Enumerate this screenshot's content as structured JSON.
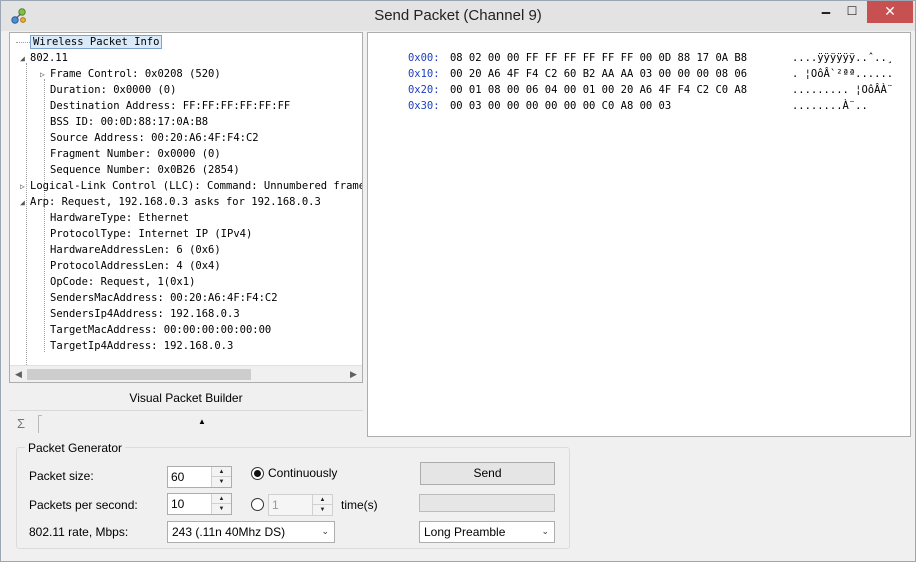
{
  "window": {
    "title": "Send Packet (Channel 9)",
    "minimize_glyph": "🗕",
    "maximize_glyph": "☐",
    "close_glyph": "✕"
  },
  "tree": {
    "rows": [
      {
        "text": "Wireless Packet Info",
        "expander": ""
      },
      {
        "text": "802.11",
        "expander": "◢"
      },
      {
        "text": "Frame Control: 0x0208 (520)",
        "expander": "▷"
      },
      {
        "text": "Duration: 0x0000 (0)",
        "expander": ""
      },
      {
        "text": "Destination Address: FF:FF:FF:FF:FF:FF",
        "expander": ""
      },
      {
        "text": "BSS ID: 00:0D:88:17:0A:B8",
        "expander": ""
      },
      {
        "text": "Source Address: 00:20:A6:4F:F4:C2",
        "expander": ""
      },
      {
        "text": "Fragment Number: 0x0000 (0)",
        "expander": ""
      },
      {
        "text": "Sequence Number: 0x0B26 (2854)",
        "expander": ""
      },
      {
        "text": "Logical-Link Control (LLC): Command: Unnumbered frame,",
        "expander": "▷"
      },
      {
        "text": "Arp: Request, 192.168.0.3 asks for 192.168.0.3",
        "expander": "◢"
      },
      {
        "text": "HardwareType: Ethernet",
        "expander": ""
      },
      {
        "text": "ProtocolType: Internet IP (IPv4)",
        "expander": ""
      },
      {
        "text": "HardwareAddressLen: 6 (0x6)",
        "expander": ""
      },
      {
        "text": "ProtocolAddressLen: 4 (0x4)",
        "expander": ""
      },
      {
        "text": "OpCode: Request, 1(0x1)",
        "expander": ""
      },
      {
        "text": "SendersMacAddress: 00:20:A6:4F:F4:C2",
        "expander": ""
      },
      {
        "text": "SendersIp4Address: 192.168.0.3",
        "expander": ""
      },
      {
        "text": "TargetMacAddress: 00:00:00:00:00:00",
        "expander": ""
      },
      {
        "text": "TargetIp4Address: 192.168.0.3",
        "expander": ""
      }
    ],
    "scroll_left_glyph": "◀",
    "scroll_right_glyph": "▶"
  },
  "visual_builder": {
    "label": "Visual Packet Builder",
    "sigma_glyph": "Σ",
    "collapse_glyph": "▲"
  },
  "hex": {
    "rows": [
      {
        "offset": "0x00:",
        "bytes": "08 02 00 00 FF FF FF FF FF FF 00 0D 88 17 0A B8",
        "ascii": "....ÿÿÿÿÿÿ..ˆ..¸"
      },
      {
        "offset": "0x10:",
        "bytes": "00 20 A6 4F F4 C2 60 B2 AA AA 03 00 00 00 08 06",
        "ascii": ". ¦OôÂ`²ªª......"
      },
      {
        "offset": "0x20:",
        "bytes": "00 01 08 00 06 04 00 01 00 20 A6 4F F4 C2 C0 A8",
        "ascii": "......... ¦OôÂÀ¨"
      },
      {
        "offset": "0x30:",
        "bytes": "00 03 00 00 00 00 00 00 C0 A8 00 03",
        "ascii": "........À¨.."
      }
    ]
  },
  "generator": {
    "legend": "Packet Generator",
    "packet_size_label": "Packet size:",
    "packet_size_value": "60",
    "pps_label": "Packets per second:",
    "pps_value": "10",
    "rate_label": "802.11 rate, Mbps:",
    "rate_value": "243 (.11n 40Mhz DS)",
    "continuously_label": "Continuously",
    "times_value": "1",
    "times_label": "time(s)",
    "send_label": "Send",
    "progress": 0,
    "preamble_value": "Long Preamble",
    "spin_up_glyph": "▲",
    "spin_down_glyph": "▼",
    "select_caret_glyph": "⌄"
  },
  "colors": {
    "hex_offset": "#1b3fc2",
    "close_button": "#c75050",
    "tree_selection": "#dbeaf9"
  }
}
